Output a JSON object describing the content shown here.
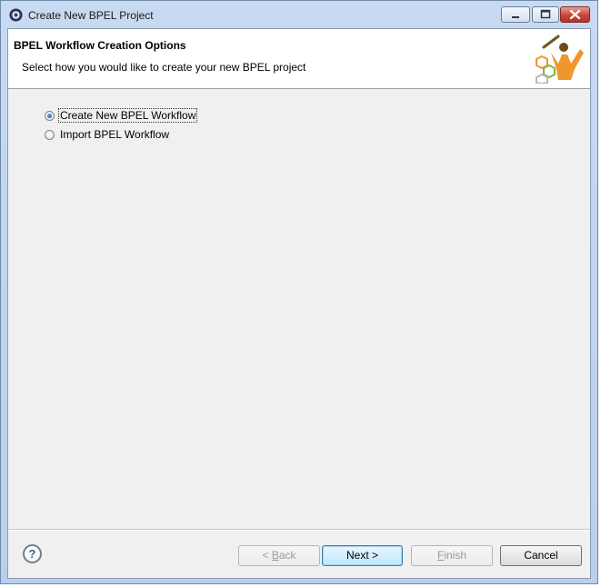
{
  "window": {
    "title": "Create New BPEL Project"
  },
  "header": {
    "title": "BPEL Workflow Creation Options",
    "description": "Select how you would like to create your new BPEL project"
  },
  "options": [
    {
      "label": "Create New BPEL Workflow",
      "selected": true
    },
    {
      "label": "Import BPEL Workflow",
      "selected": false
    }
  ],
  "help": {
    "glyph": "?"
  },
  "buttons": {
    "back": {
      "prefix": "< ",
      "mnemonic": "B",
      "rest": "ack",
      "enabled": false
    },
    "next": {
      "label": "Next >",
      "enabled": true
    },
    "finish": {
      "mnemonic": "F",
      "rest": "inish",
      "enabled": false
    },
    "cancel": {
      "label": "Cancel",
      "enabled": true
    }
  },
  "colors": {
    "title_gradient_top": "#c8daf1",
    "close_red": "#c7453a",
    "logo_orange": "#f0962a",
    "logo_green": "#7fb842"
  }
}
